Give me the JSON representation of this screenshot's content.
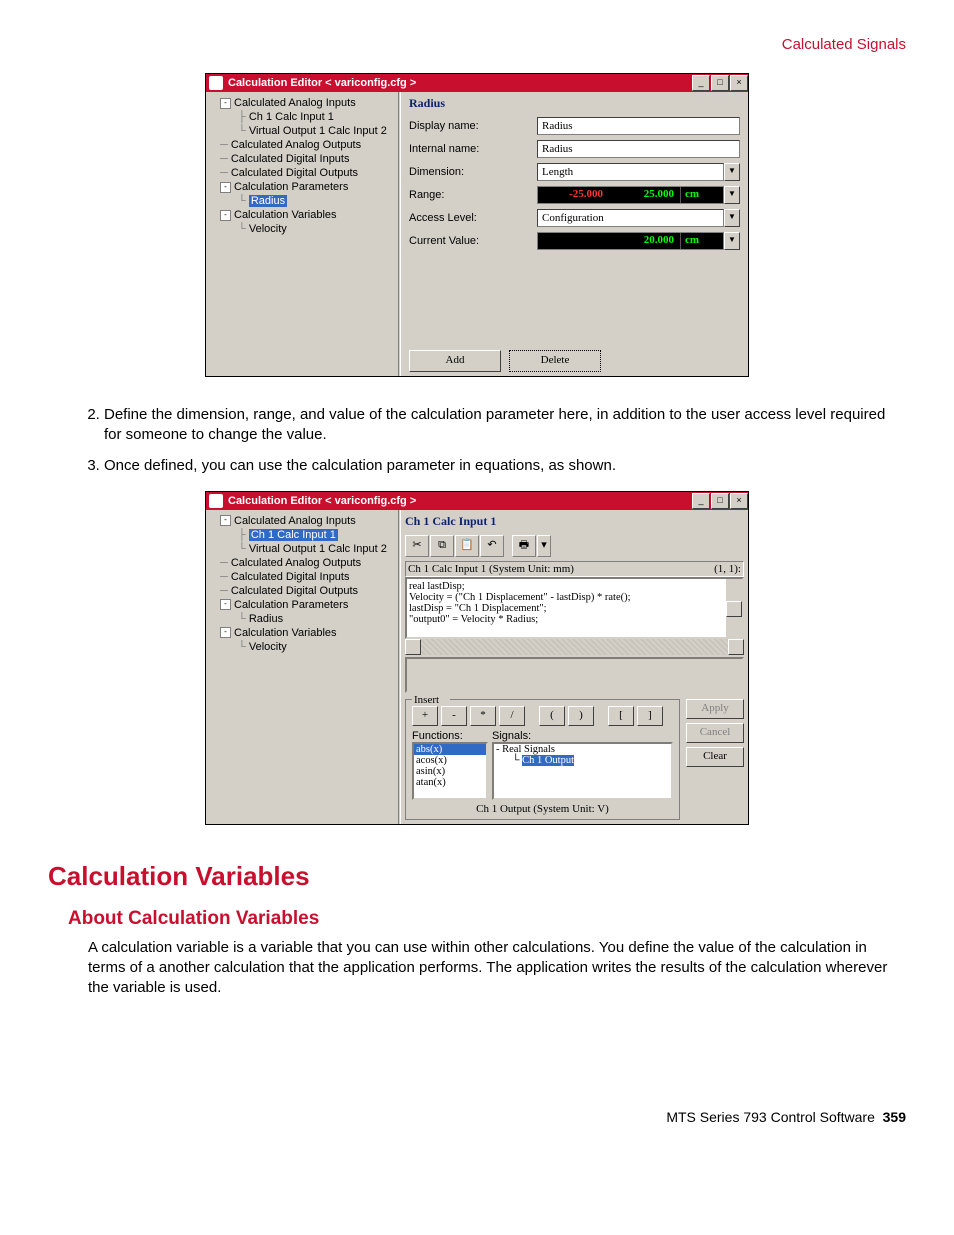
{
  "header_right": "Calculated Signals",
  "win_title": "Calculation Editor < variconfig.cfg >",
  "tree": {
    "ana_in": "Calculated Analog Inputs",
    "ch1": "Ch 1 Calc Input 1",
    "vo1": "Virtual Output 1 Calc Input 2",
    "ana_out": "Calculated Analog Outputs",
    "dig_in": "Calculated Digital Inputs",
    "dig_out": "Calculated Digital Outputs",
    "params": "Calculation Parameters",
    "radius": "Radius",
    "vars": "Calculation Variables",
    "velocity": "Velocity"
  },
  "form1": {
    "heading": "Radius",
    "display_name_lbl": "Display name:",
    "display_name": "Radius",
    "internal_name_lbl": "Internal name:",
    "internal_name": "Radius",
    "dimension_lbl": "Dimension:",
    "dimension": "Length",
    "range_lbl": "Range:",
    "range_min": "-25.000",
    "range_max": "25.000",
    "range_unit": "cm",
    "access_lbl": "Access Level:",
    "access": "Configuration",
    "cur_lbl": "Current Value:",
    "cur_val": "20.000",
    "cur_unit": "cm",
    "add": "Add",
    "delete": "Delete"
  },
  "steps": {
    "s2": "Define the dimension, range, and value of the calculation parameter here, in addition to the user access level required for someone to change the value.",
    "s3": "Once defined, you can use the calculation parameter in equations, as shown."
  },
  "form2": {
    "heading": "Ch 1 Calc Input 1",
    "status_l": "Ch 1 Calc Input 1    (System Unit:  mm)",
    "status_r": "(1, 1):",
    "code": "real lastDisp;\nVelocity = (\"Ch 1 Displacement\" - lastDisp) * rate();\nlastDisp = \"Ch 1 Displacement\";\n\"output0\" = Velocity * Radius;",
    "insert": "Insert",
    "ops": [
      "+",
      "-",
      "*",
      "/",
      "(",
      ")",
      "[",
      "]"
    ],
    "functions_lbl": "Functions:",
    "signals_lbl": "Signals:",
    "funcs": [
      "abs(x)",
      "acos(x)",
      "asin(x)",
      "atan(x)"
    ],
    "real_signals": "Real Signals",
    "ch1_out": "Ch 1 Output",
    "bottom_status": "Ch 1 Output    (System Unit:  V)",
    "apply": "Apply",
    "cancel": "Cancel",
    "clear": "Clear"
  },
  "h1": "Calculation Variables",
  "h2": "About Calculation Variables",
  "para": "A calculation variable is a variable that you can use within other calculations. You define the value of the calculation in terms of a another calculation that the application performs. The application writes the results of the calculation wherever the variable is used.",
  "footer_product": "MTS Series 793 Control Software",
  "footer_page": "359"
}
